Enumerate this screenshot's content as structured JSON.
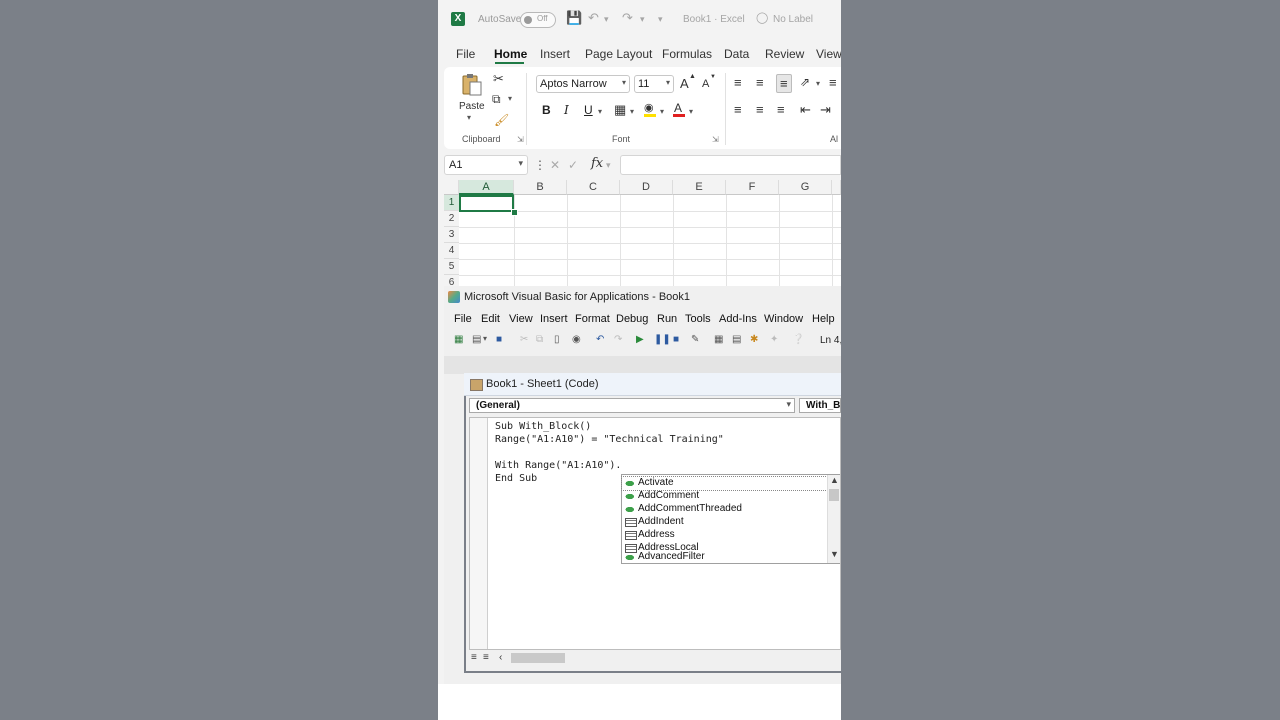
{
  "titlebar": {
    "autosave_label": "AutoSave",
    "autosave_state": "Off",
    "doc_title": "Book1 · Excel",
    "label_text": "No Label"
  },
  "ribbon_tabs": [
    "File",
    "Home",
    "Insert",
    "Page Layout",
    "Formulas",
    "Data",
    "Review",
    "View"
  ],
  "ribbon": {
    "paste_label": "Paste",
    "clipboard_group": "Clipboard",
    "font_group": "Font",
    "font_name": "Aptos Narrow",
    "font_size": "11",
    "bold": "B",
    "italic": "I",
    "underline": "U",
    "grow_font": "A",
    "shrink_font": "A",
    "font_color_letter": "A",
    "alignment_group_partial": "Al"
  },
  "formula_bar": {
    "name_box": "A1",
    "fx": "fx",
    "value": ""
  },
  "grid": {
    "columns": [
      "A",
      "B",
      "C",
      "D",
      "E",
      "F",
      "G"
    ],
    "rows": [
      "1",
      "2",
      "3",
      "4",
      "5",
      "6"
    ],
    "active_cell": "A1"
  },
  "vba": {
    "window_title": "Microsoft Visual Basic for Applications - Book1",
    "menu": [
      "File",
      "Edit",
      "View",
      "Insert",
      "Format",
      "Debug",
      "Run",
      "Tools",
      "Add-Ins",
      "Window",
      "Help"
    ],
    "status": "Ln 4,",
    "code_window_title": "Book1 - Sheet1 (Code)",
    "object_combo": "(General)",
    "proc_combo": "With_Block",
    "code_lines": [
      "Sub With_Block()",
      "Range(\"A1:A10\") = \"Technical Training\"",
      "",
      "With Range(\"A1:A10\").",
      "End Sub"
    ],
    "autocomplete": [
      {
        "label": "Activate",
        "kind": "method"
      },
      {
        "label": "AddComment",
        "kind": "method"
      },
      {
        "label": "AddCommentThreaded",
        "kind": "method"
      },
      {
        "label": "AddIndent",
        "kind": "property"
      },
      {
        "label": "Address",
        "kind": "property"
      },
      {
        "label": "AddressLocal",
        "kind": "property"
      },
      {
        "label": "AdvancedFilter",
        "kind": "method"
      }
    ]
  },
  "colors": {
    "excel_green": "#1f7a45",
    "background": "#7b8088"
  }
}
